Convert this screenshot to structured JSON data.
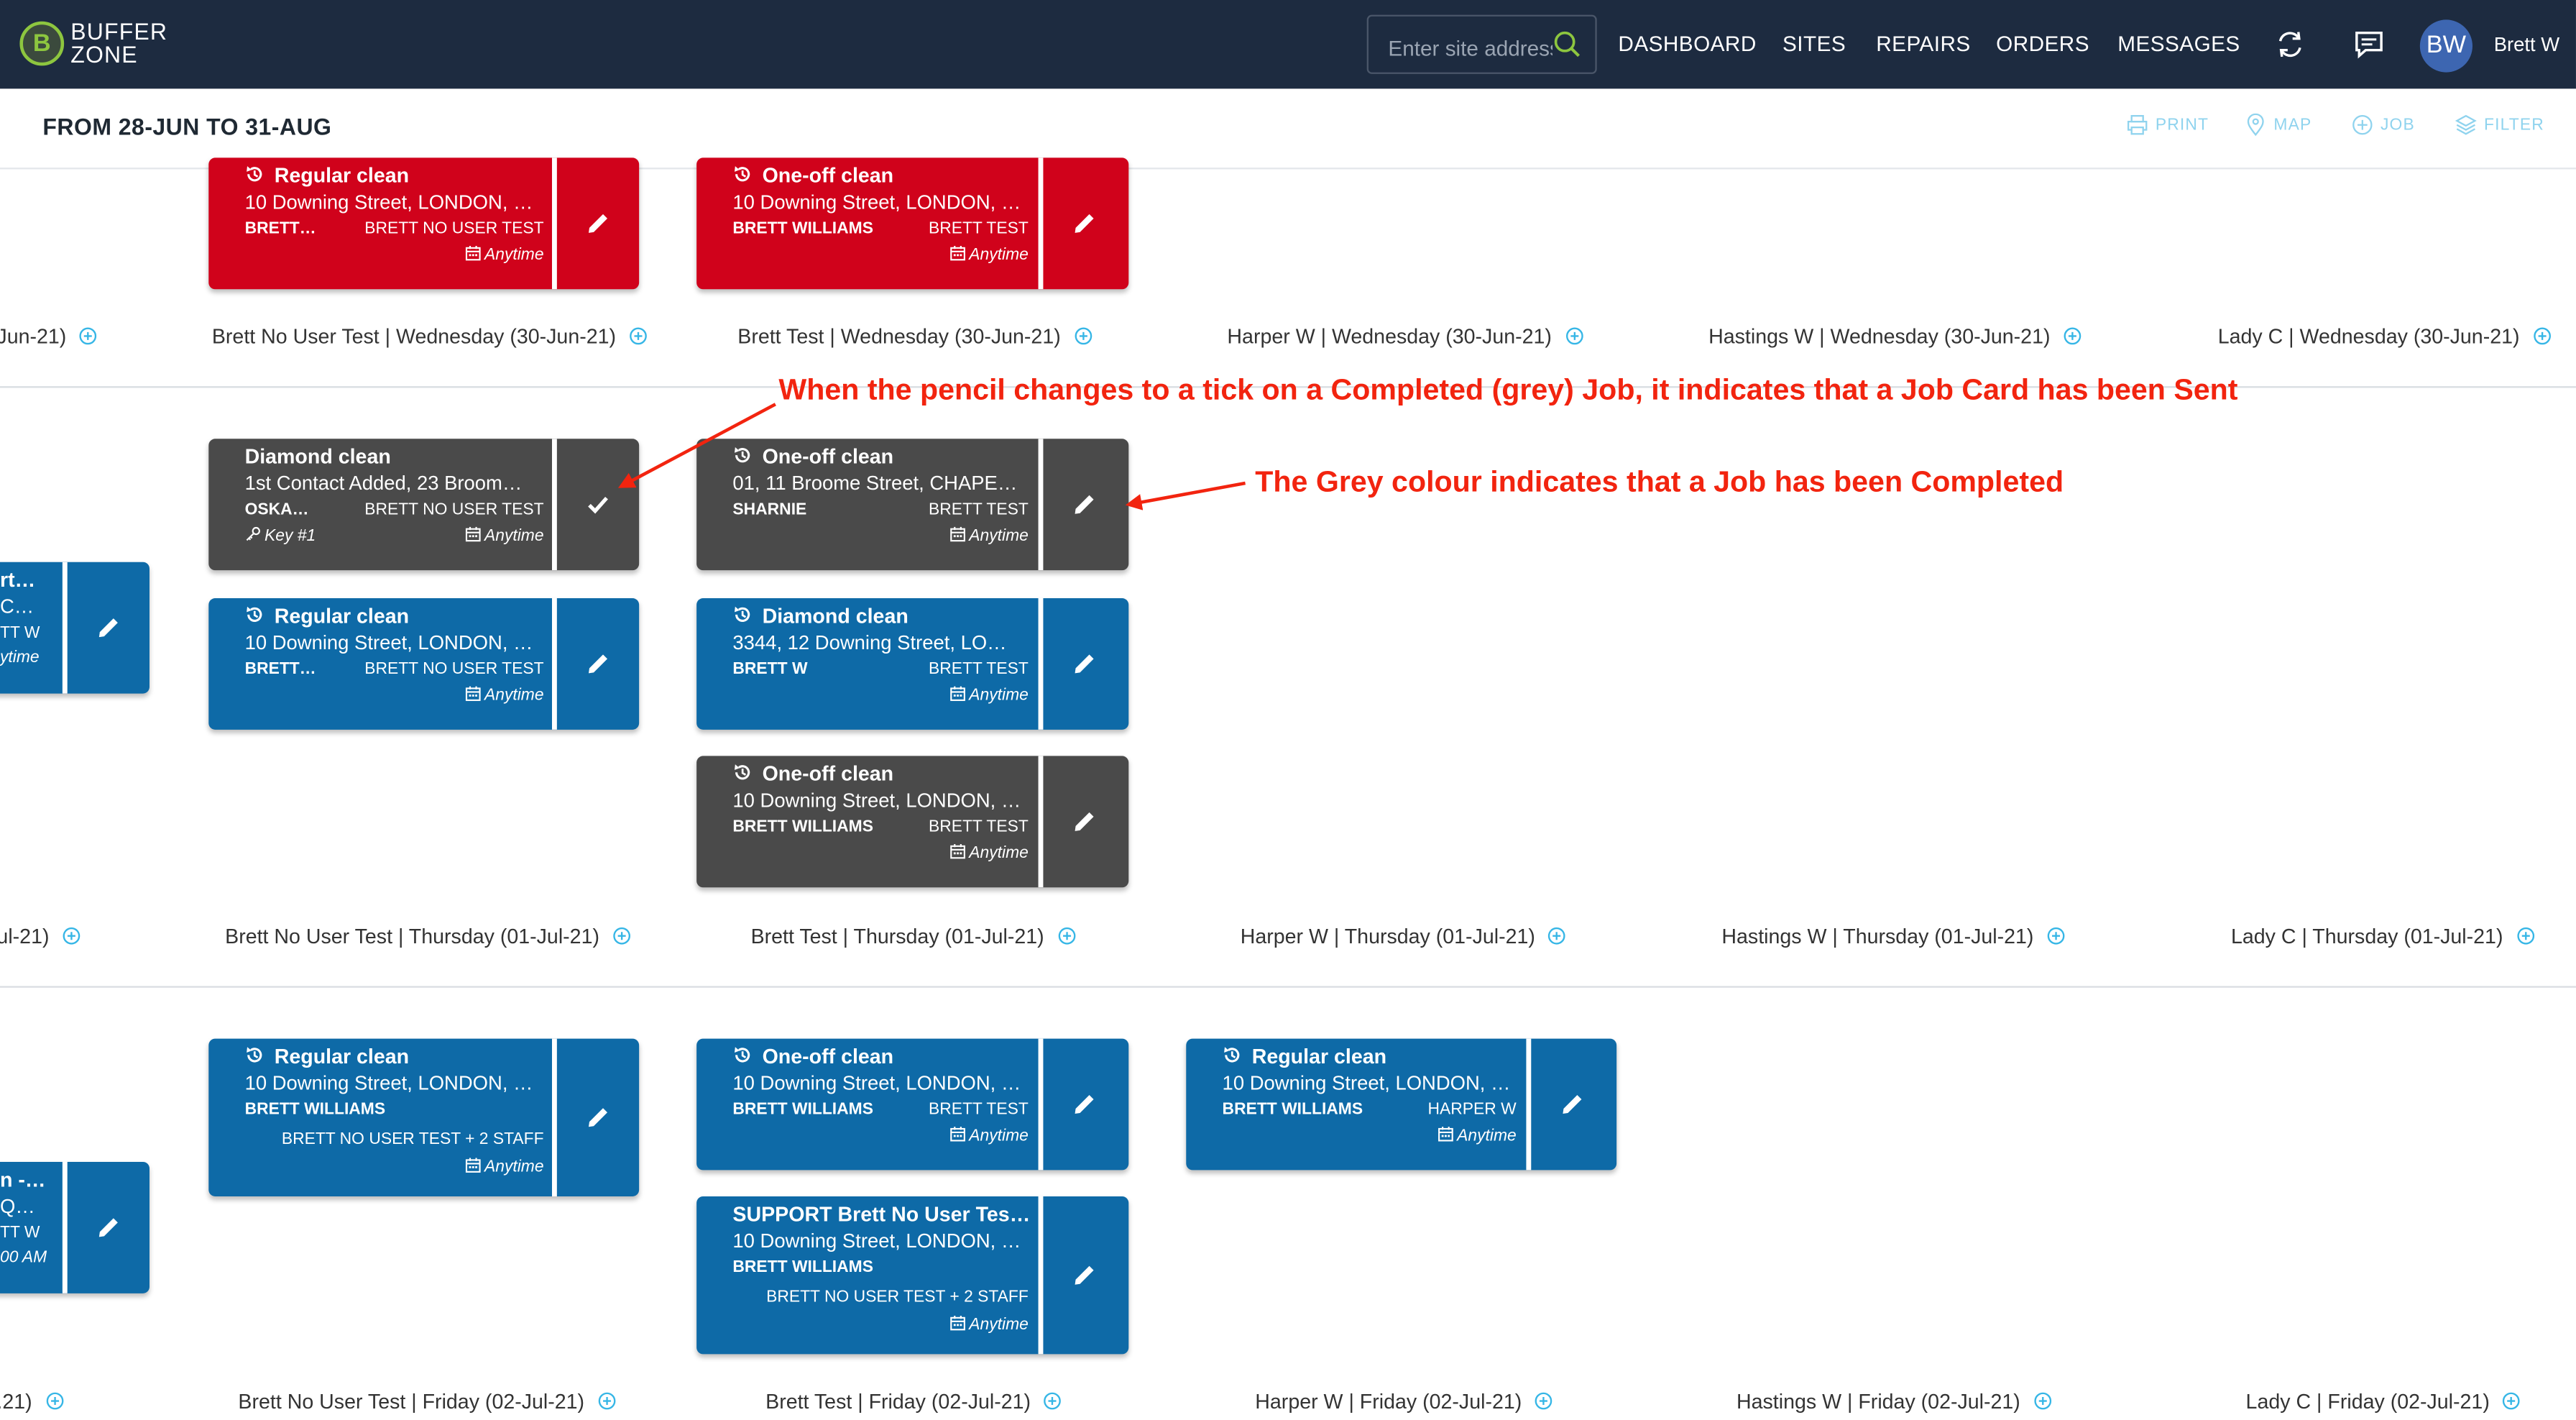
{
  "header": {
    "logo_line1": "BUFFER",
    "logo_line2": "ZONE",
    "logo_letter": "B",
    "search_placeholder": "Enter site address",
    "nav": [
      "DASHBOARD",
      "SITES",
      "REPAIRS",
      "ORDERS",
      "MESSAGES"
    ],
    "avatar_initials": "BW",
    "user_name": "Brett W"
  },
  "subheader": {
    "range": "FROM 28-JUN TO 31-AUG",
    "tools": [
      "PRINT",
      "MAP",
      "JOB",
      "FILTER"
    ]
  },
  "colors": {
    "topbar": "#1d2b40",
    "red": "#d0021b",
    "blue": "#0e6aa7",
    "grey": "#4a4a4a",
    "annotation": "#f2240f",
    "accent": "#8fd3ee"
  },
  "rows": [
    {
      "labels": [
        "Jun-21)",
        "Brett No User Test | Wednesday (30-Jun-21)",
        "Brett Test | Wednesday (30-Jun-21)",
        "Harper W | Wednesday (30-Jun-21)",
        "Hastings W | Wednesday (30-Jun-21)",
        "Lady C | Wednesday (30-Jun-21)"
      ],
      "cards": [
        {
          "title": "Regular clean",
          "address": "10 Downing Street, LONDON, …",
          "name": "BRETT…",
          "staff": "BRETT NO USER TEST",
          "time": "Anytime"
        },
        {
          "title": "One-off clean",
          "address": "10 Downing Street, LONDON, …",
          "name": "BRETT WILLIAMS",
          "staff": "BRETT TEST",
          "time": "Anytime"
        }
      ]
    },
    {
      "labels": [
        "ul-21)",
        "Brett No User Test | Thursday (01-Jul-21)",
        "Brett Test | Thursday (01-Jul-21)",
        "Harper W | Thursday (01-Jul-21)",
        "Hastings W | Thursday (01-Jul-21)",
        "Lady C | Thursday (01-Jul-21)"
      ],
      "cards": [
        {
          "title": "rt…",
          "address": "C…",
          "staff": "TT W",
          "time": "ytime"
        },
        {
          "title": "Diamond clean",
          "address": "1st Contact Added, 23 Broom…",
          "name": "OSKA…",
          "staff": "BRETT NO USER TEST",
          "key": "Key #1",
          "time": "Anytime"
        },
        {
          "title": "Regular clean",
          "address": "10 Downing Street, LONDON, …",
          "name": "BRETT…",
          "staff": "BRETT NO USER TEST",
          "time": "Anytime"
        },
        {
          "title": "One-off clean",
          "address": "01, 11 Broome Street, CHAPE…",
          "name": "SHARNIE",
          "staff": "BRETT TEST",
          "time": "Anytime"
        },
        {
          "title": "Diamond clean",
          "address": "3344, 12 Downing Street, LO…",
          "name": "BRETT W",
          "staff": "BRETT TEST",
          "time": "Anytime"
        },
        {
          "title": "One-off clean",
          "address": "10 Downing Street, LONDON, …",
          "name": "BRETT WILLIAMS",
          "staff": "BRETT TEST",
          "time": "Anytime"
        }
      ]
    },
    {
      "labels": [
        ".21)",
        "Brett No User Test | Friday (02-Jul-21)",
        "Brett Test | Friday (02-Jul-21)",
        "Harper W | Friday (02-Jul-21)",
        "Hastings W | Friday (02-Jul-21)",
        "Lady C | Friday (02-Jul-21)"
      ],
      "cards": [
        {
          "title": "n -…",
          "address": "Q…",
          "staff": "TT W",
          "time": "00 AM"
        },
        {
          "title": "Regular clean",
          "address": "10 Downing Street, LONDON, …",
          "name": "BRETT WILLIAMS",
          "staff": "BRETT NO USER TEST + 2 STAFF",
          "time": "Anytime"
        },
        {
          "title": "One-off clean",
          "address": "10 Downing Street, LONDON, …",
          "name": "BRETT WILLIAMS",
          "staff": "BRETT TEST",
          "time": "Anytime"
        },
        {
          "title": "SUPPORT Brett No User Tes…",
          "address": "10 Downing Street, LONDON, …",
          "name": "BRETT WILLIAMS",
          "staff": "BRETT NO USER TEST + 2 STAFF",
          "time": "Anytime"
        },
        {
          "title": "Regular clean",
          "address": "10 Downing Street, LONDON, …",
          "name": "BRETT WILLIAMS",
          "staff": "HARPER W",
          "time": "Anytime"
        }
      ]
    }
  ],
  "annotations": {
    "tick": "When the pencil changes to a tick on a Completed (grey) Job, it indicates that a Job Card has been Sent",
    "grey": "The Grey colour indicates that a Job has been Completed"
  }
}
